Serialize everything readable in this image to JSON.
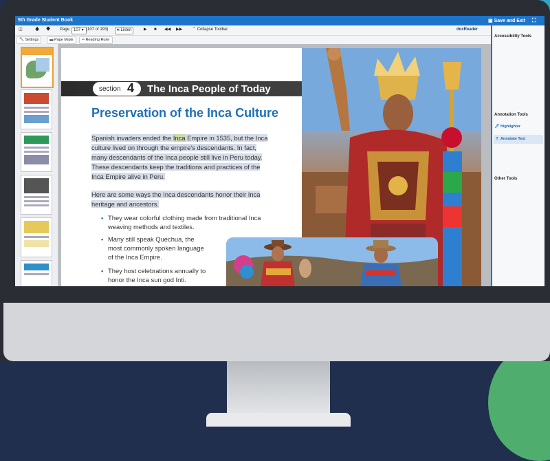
{
  "app": {
    "title": "5th Grade Student Book",
    "save_exit": "Save and Exit",
    "brand": "docReader"
  },
  "toolbar": {
    "page_label": "Page",
    "page_value": "107",
    "page_of": "(107 of 193)",
    "listen": "Listen",
    "collapse": "Collapse Toolbar",
    "settings": "Settings",
    "page_mask": "Page Mask",
    "reading_ruler": "Reading Ruler"
  },
  "panel": {
    "accessibility": "Accessibility Tools",
    "annotation": "Annotation Tools",
    "highlighter": "Highlighter",
    "annotate_text": "Annotate Text",
    "other": "Other Tools"
  },
  "colors": {
    "accent": "#1d74c9",
    "heading": "#1e6fb8",
    "palette_green": "#22b02c"
  },
  "page": {
    "section_word": "section",
    "section_num": "4",
    "section_title": "The Inca People of Today",
    "heading": "Preservation of the Inca Culture",
    "para1": [
      "Spanish invaders ended the ",
      "Inca",
      " Empire in 1535, but the Inca",
      "culture lived on through the empire's descendants.  In fact,",
      "many descendants of the Inca people still live in Peru today.",
      "These descendants keep the traditions and practices of the",
      "Inca Empire alive in Peru."
    ],
    "para2": [
      "Here are some ways the Inca descendants honor their Inca",
      "heritage and ancestors."
    ],
    "bullets": [
      [
        "They wear colorful clothing made from traditional Inca",
        "weaving methods and textiles."
      ],
      [
        "Many still speak Quechua, the",
        "most commonly spoken language",
        "of the Inca Empire."
      ],
      [
        "They host celebrations annually to",
        "honor the Inca sun god Inti."
      ]
    ]
  }
}
